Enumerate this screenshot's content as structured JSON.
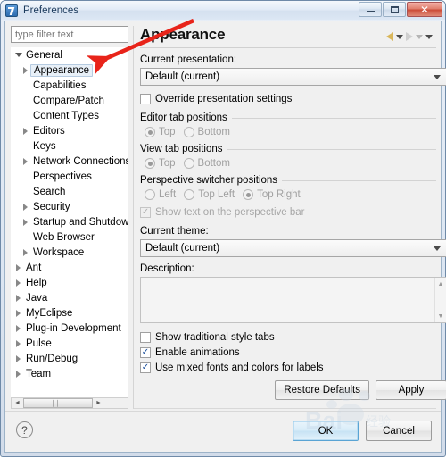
{
  "window": {
    "title": "Preferences",
    "icon": "eclipse-preferences-icon",
    "controls": {
      "minimize": "minimize-button",
      "maximize": "maximize-button",
      "close_glyph": "✕"
    }
  },
  "filter": {
    "placeholder": "type filter text",
    "value": ""
  },
  "tree": {
    "items": [
      {
        "label": "General",
        "level": 0,
        "twisty": "open",
        "selected": false
      },
      {
        "label": "Appearance",
        "level": 1,
        "twisty": "closed",
        "selected": true
      },
      {
        "label": "Capabilities",
        "level": 1,
        "twisty": "none",
        "selected": false
      },
      {
        "label": "Compare/Patch",
        "level": 1,
        "twisty": "none",
        "selected": false
      },
      {
        "label": "Content Types",
        "level": 1,
        "twisty": "none",
        "selected": false
      },
      {
        "label": "Editors",
        "level": 1,
        "twisty": "closed",
        "selected": false
      },
      {
        "label": "Keys",
        "level": 1,
        "twisty": "none",
        "selected": false
      },
      {
        "label": "Network Connections",
        "level": 1,
        "twisty": "closed",
        "selected": false
      },
      {
        "label": "Perspectives",
        "level": 1,
        "twisty": "none",
        "selected": false
      },
      {
        "label": "Search",
        "level": 1,
        "twisty": "none",
        "selected": false
      },
      {
        "label": "Security",
        "level": 1,
        "twisty": "closed",
        "selected": false
      },
      {
        "label": "Startup and Shutdown",
        "level": 1,
        "twisty": "closed",
        "selected": false
      },
      {
        "label": "Web Browser",
        "level": 1,
        "twisty": "none",
        "selected": false
      },
      {
        "label": "Workspace",
        "level": 1,
        "twisty": "closed",
        "selected": false
      },
      {
        "label": "Ant",
        "level": 0,
        "twisty": "closed",
        "selected": false
      },
      {
        "label": "Help",
        "level": 0,
        "twisty": "closed",
        "selected": false
      },
      {
        "label": "Java",
        "level": 0,
        "twisty": "closed",
        "selected": false
      },
      {
        "label": "MyEclipse",
        "level": 0,
        "twisty": "closed",
        "selected": false
      },
      {
        "label": "Plug-in Development",
        "level": 0,
        "twisty": "closed",
        "selected": false
      },
      {
        "label": "Pulse",
        "level": 0,
        "twisty": "closed",
        "selected": false
      },
      {
        "label": "Run/Debug",
        "level": 0,
        "twisty": "closed",
        "selected": false
      },
      {
        "label": "Team",
        "level": 0,
        "twisty": "closed",
        "selected": false
      }
    ]
  },
  "page": {
    "title": "Appearance",
    "nav": {
      "back": "back-arrow",
      "back_menu": "back-dropdown",
      "forward": "forward-arrow",
      "forward_menu": "forward-dropdown",
      "view_menu": "view-menu"
    },
    "current_presentation": {
      "label": "Current presentation:",
      "value": "Default (current)"
    },
    "override": {
      "label": "Override presentation settings",
      "checked": false,
      "enabled": true
    },
    "editor_tab_positions": {
      "legend": "Editor tab positions",
      "options": [
        "Top",
        "Bottom"
      ],
      "selected": "Top",
      "enabled": false
    },
    "view_tab_positions": {
      "legend": "View tab positions",
      "options": [
        "Top",
        "Bottom"
      ],
      "selected": "Top",
      "enabled": false
    },
    "perspective_switcher_positions": {
      "legend": "Perspective switcher positions",
      "options": [
        "Left",
        "Top Left",
        "Top Right"
      ],
      "selected": "Top Right",
      "enabled": false
    },
    "show_text_perspective_bar": {
      "label": "Show text on the perspective bar",
      "checked": true,
      "enabled": false
    },
    "current_theme": {
      "label": "Current theme:",
      "value": "Default (current)"
    },
    "description": {
      "label": "Description:",
      "value": ""
    },
    "checkboxes": [
      {
        "label": "Show traditional style tabs",
        "checked": false
      },
      {
        "label": "Enable animations",
        "checked": true
      },
      {
        "label": "Use mixed fonts and colors for labels",
        "checked": true
      }
    ],
    "buttons": {
      "restore_defaults": "Restore Defaults",
      "apply": "Apply"
    }
  },
  "footer": {
    "help": "?",
    "ok": "OK",
    "cancel": "Cancel"
  },
  "scrollbars": {
    "tree_h_left": "◄",
    "tree_h_right": "►",
    "desc_up": "▲",
    "desc_down": "▼",
    "thumb_grip": "∣∣∣"
  },
  "annotation": {
    "type": "red-arrow",
    "color": "#e8241a",
    "points_to": "Appearance"
  },
  "watermark": {
    "text": "Bai",
    "sub": "经验"
  }
}
